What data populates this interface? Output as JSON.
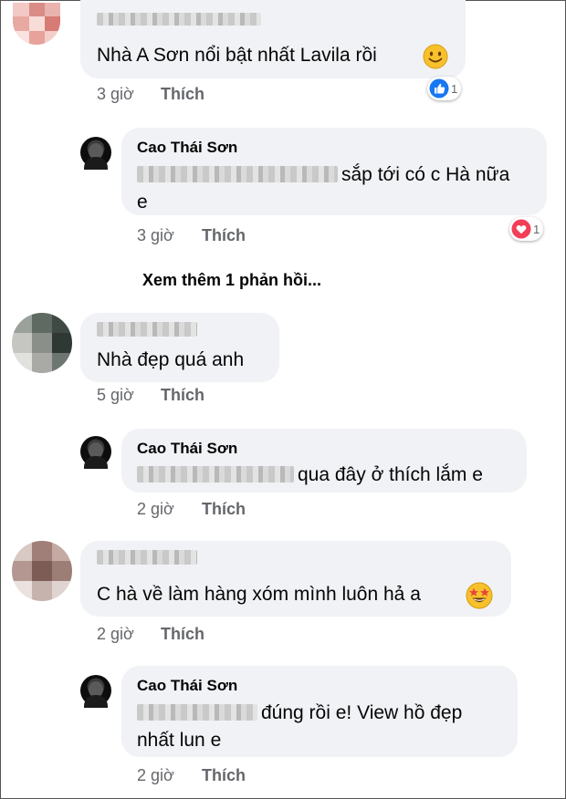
{
  "comments": [
    {
      "text": "Nhà A Sơn nổi bật nhất Lavila rồi",
      "time": "3 giờ",
      "like_label": "Thích",
      "reaction": {
        "type": "like",
        "count": "1"
      }
    },
    {
      "reply_name": "Cao Thái Sơn",
      "reply_text_line1": "sắp tới có c Hà nữa",
      "reply_text_line2": "e",
      "reply_time": "3 giờ",
      "reply_like_label": "Thích",
      "reply_reaction": {
        "type": "love",
        "count": "1"
      },
      "more_replies": "Xem thêm 1 phản hồi..."
    },
    {
      "text": "Nhà đẹp quá anh",
      "time": "5 giờ",
      "like_label": "Thích",
      "reply_name": "Cao Thái Sơn",
      "reply_text": "qua đây ở thích lắm e",
      "reply_time": "2 giờ",
      "reply_like_label": "Thích"
    },
    {
      "text": "C hà về làm hàng xóm mình luôn hả a",
      "time": "2 giờ",
      "like_label": "Thích",
      "reply_name": "Cao Thái Sơn",
      "reply_text_line1": "đúng rồi e! View hồ đẹp",
      "reply_text_line2": "nhất lun e",
      "reply_time": "2 giờ",
      "reply_like_label": "Thích"
    }
  ],
  "colors": {
    "bubble": "#f0f2f5",
    "meta_text": "#65676b",
    "like_blue": "#1877f2",
    "love_red": "#f33e58"
  },
  "icons": [
    "smile-emoji-icon",
    "like-reaction-icon",
    "love-reaction-icon",
    "star-struck-emoji-icon",
    "avatar-pixelated",
    "profile-photo"
  ]
}
